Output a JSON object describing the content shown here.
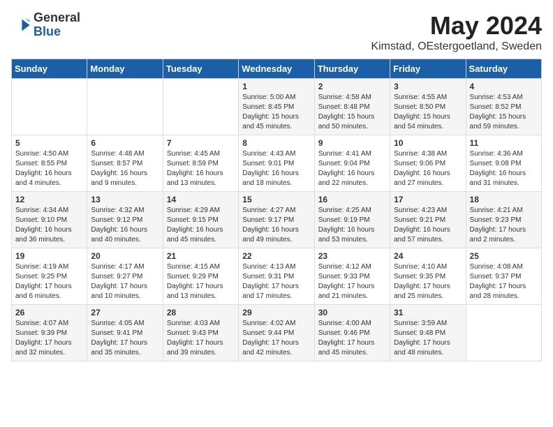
{
  "logo": {
    "general": "General",
    "blue": "Blue"
  },
  "title": "May 2024",
  "location": "Kimstad, OEstergoetland, Sweden",
  "days_of_week": [
    "Sunday",
    "Monday",
    "Tuesday",
    "Wednesday",
    "Thursday",
    "Friday",
    "Saturday"
  ],
  "weeks": [
    [
      {
        "day": "",
        "content": ""
      },
      {
        "day": "",
        "content": ""
      },
      {
        "day": "",
        "content": ""
      },
      {
        "day": "1",
        "content": "Sunrise: 5:00 AM\nSunset: 8:45 PM\nDaylight: 15 hours\nand 45 minutes."
      },
      {
        "day": "2",
        "content": "Sunrise: 4:58 AM\nSunset: 8:48 PM\nDaylight: 15 hours\nand 50 minutes."
      },
      {
        "day": "3",
        "content": "Sunrise: 4:55 AM\nSunset: 8:50 PM\nDaylight: 15 hours\nand 54 minutes."
      },
      {
        "day": "4",
        "content": "Sunrise: 4:53 AM\nSunset: 8:52 PM\nDaylight: 15 hours\nand 59 minutes."
      }
    ],
    [
      {
        "day": "5",
        "content": "Sunrise: 4:50 AM\nSunset: 8:55 PM\nDaylight: 16 hours\nand 4 minutes."
      },
      {
        "day": "6",
        "content": "Sunrise: 4:48 AM\nSunset: 8:57 PM\nDaylight: 16 hours\nand 9 minutes."
      },
      {
        "day": "7",
        "content": "Sunrise: 4:45 AM\nSunset: 8:59 PM\nDaylight: 16 hours\nand 13 minutes."
      },
      {
        "day": "8",
        "content": "Sunrise: 4:43 AM\nSunset: 9:01 PM\nDaylight: 16 hours\nand 18 minutes."
      },
      {
        "day": "9",
        "content": "Sunrise: 4:41 AM\nSunset: 9:04 PM\nDaylight: 16 hours\nand 22 minutes."
      },
      {
        "day": "10",
        "content": "Sunrise: 4:38 AM\nSunset: 9:06 PM\nDaylight: 16 hours\nand 27 minutes."
      },
      {
        "day": "11",
        "content": "Sunrise: 4:36 AM\nSunset: 9:08 PM\nDaylight: 16 hours\nand 31 minutes."
      }
    ],
    [
      {
        "day": "12",
        "content": "Sunrise: 4:34 AM\nSunset: 9:10 PM\nDaylight: 16 hours\nand 36 minutes."
      },
      {
        "day": "13",
        "content": "Sunrise: 4:32 AM\nSunset: 9:12 PM\nDaylight: 16 hours\nand 40 minutes."
      },
      {
        "day": "14",
        "content": "Sunrise: 4:29 AM\nSunset: 9:15 PM\nDaylight: 16 hours\nand 45 minutes."
      },
      {
        "day": "15",
        "content": "Sunrise: 4:27 AM\nSunset: 9:17 PM\nDaylight: 16 hours\nand 49 minutes."
      },
      {
        "day": "16",
        "content": "Sunrise: 4:25 AM\nSunset: 9:19 PM\nDaylight: 16 hours\nand 53 minutes."
      },
      {
        "day": "17",
        "content": "Sunrise: 4:23 AM\nSunset: 9:21 PM\nDaylight: 16 hours\nand 57 minutes."
      },
      {
        "day": "18",
        "content": "Sunrise: 4:21 AM\nSunset: 9:23 PM\nDaylight: 17 hours\nand 2 minutes."
      }
    ],
    [
      {
        "day": "19",
        "content": "Sunrise: 4:19 AM\nSunset: 9:25 PM\nDaylight: 17 hours\nand 6 minutes."
      },
      {
        "day": "20",
        "content": "Sunrise: 4:17 AM\nSunset: 9:27 PM\nDaylight: 17 hours\nand 10 minutes."
      },
      {
        "day": "21",
        "content": "Sunrise: 4:15 AM\nSunset: 9:29 PM\nDaylight: 17 hours\nand 13 minutes."
      },
      {
        "day": "22",
        "content": "Sunrise: 4:13 AM\nSunset: 9:31 PM\nDaylight: 17 hours\nand 17 minutes."
      },
      {
        "day": "23",
        "content": "Sunrise: 4:12 AM\nSunset: 9:33 PM\nDaylight: 17 hours\nand 21 minutes."
      },
      {
        "day": "24",
        "content": "Sunrise: 4:10 AM\nSunset: 9:35 PM\nDaylight: 17 hours\nand 25 minutes."
      },
      {
        "day": "25",
        "content": "Sunrise: 4:08 AM\nSunset: 9:37 PM\nDaylight: 17 hours\nand 28 minutes."
      }
    ],
    [
      {
        "day": "26",
        "content": "Sunrise: 4:07 AM\nSunset: 9:39 PM\nDaylight: 17 hours\nand 32 minutes."
      },
      {
        "day": "27",
        "content": "Sunrise: 4:05 AM\nSunset: 9:41 PM\nDaylight: 17 hours\nand 35 minutes."
      },
      {
        "day": "28",
        "content": "Sunrise: 4:03 AM\nSunset: 9:43 PM\nDaylight: 17 hours\nand 39 minutes."
      },
      {
        "day": "29",
        "content": "Sunrise: 4:02 AM\nSunset: 9:44 PM\nDaylight: 17 hours\nand 42 minutes."
      },
      {
        "day": "30",
        "content": "Sunrise: 4:00 AM\nSunset: 9:46 PM\nDaylight: 17 hours\nand 45 minutes."
      },
      {
        "day": "31",
        "content": "Sunrise: 3:59 AM\nSunset: 9:48 PM\nDaylight: 17 hours\nand 48 minutes."
      },
      {
        "day": "",
        "content": ""
      }
    ]
  ]
}
